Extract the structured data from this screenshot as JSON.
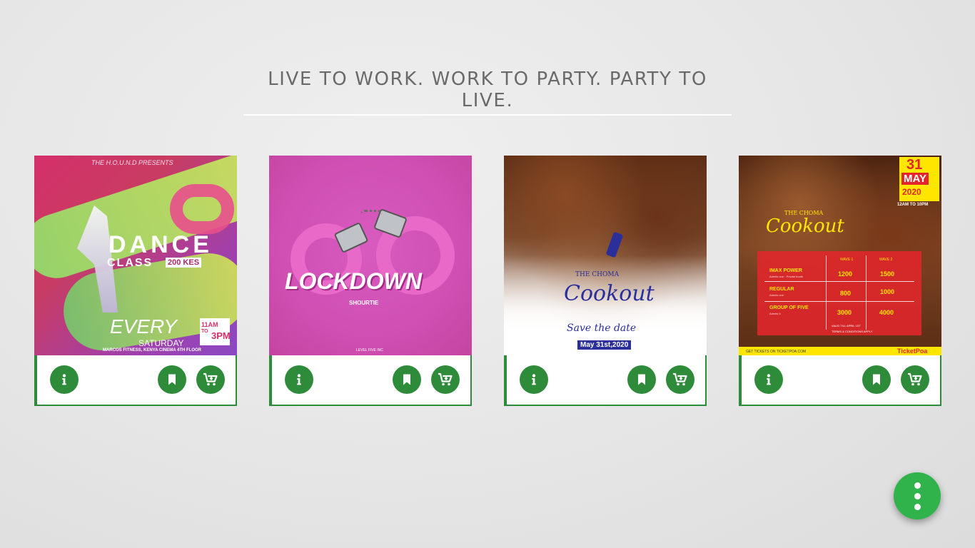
{
  "header": {
    "tagline": "LIVE TO WORK. WORK TO PARTY. PARTY TO LIVE."
  },
  "colors": {
    "accent": "#2e8b3a",
    "fab": "#2fb34a",
    "background": "#e6e6e6"
  },
  "cards": [
    {
      "poster": {
        "presents": "THE H.O.U.N.D PRESENTS",
        "title_1": "DANCE",
        "title_2": "CLASS",
        "price": "200 KES",
        "every": "EVERY",
        "day": "SATURDAY",
        "time_start": "11AM",
        "time_to": "TO",
        "time_end": "3PM",
        "venue": "MARCOS FITNESS, KENYA CINEMA 4TH FLOOR"
      },
      "icons": [
        "info-icon",
        "bookmark-icon",
        "cart-plus-icon"
      ]
    },
    {
      "poster": {
        "title": "LOCKDOWN",
        "subtitle": "SHOURTIE",
        "footer": "LEVEL FIVE INC"
      },
      "icons": [
        "info-icon",
        "bookmark-icon",
        "cart-plus-icon"
      ]
    },
    {
      "poster": {
        "brand_small": "THE CHOMA",
        "brand_script": "Cookout",
        "save_date": "Save the date",
        "date": "May 31st,2020"
      },
      "icons": [
        "info-icon",
        "bookmark-icon",
        "cart-plus-icon"
      ]
    },
    {
      "poster": {
        "day": "31",
        "month": "MAY",
        "year": "2020",
        "hours": "12AM TO 10PM",
        "brand_small": "THE CHOMA",
        "brand_script": "Cookout",
        "wave1": "WAVE 1",
        "wave2": "WAVE 2",
        "rows": [
          {
            "name": "IMAX POWER",
            "sub": "Admits one · Private booth",
            "w1": "1200",
            "w2": "1500"
          },
          {
            "name": "REGULAR",
            "sub": "Admits one",
            "w1": "800",
            "w2": "1000"
          },
          {
            "name": "GROUP OF FIVE",
            "sub": "Admits 5",
            "w1": "3000",
            "w2": "4000"
          }
        ],
        "valid": "VALID TILL APRIL 1ST",
        "terms": "TERMS & CONDITIONS APPLY",
        "tickets_on": "GET TICKETS ON TICKETPOA.COM",
        "ticketpoa": "TicketPoa"
      },
      "icons": [
        "info-icon",
        "bookmark-icon",
        "cart-plus-icon"
      ]
    }
  ],
  "fab": {
    "icon": "more-vertical-icon"
  }
}
